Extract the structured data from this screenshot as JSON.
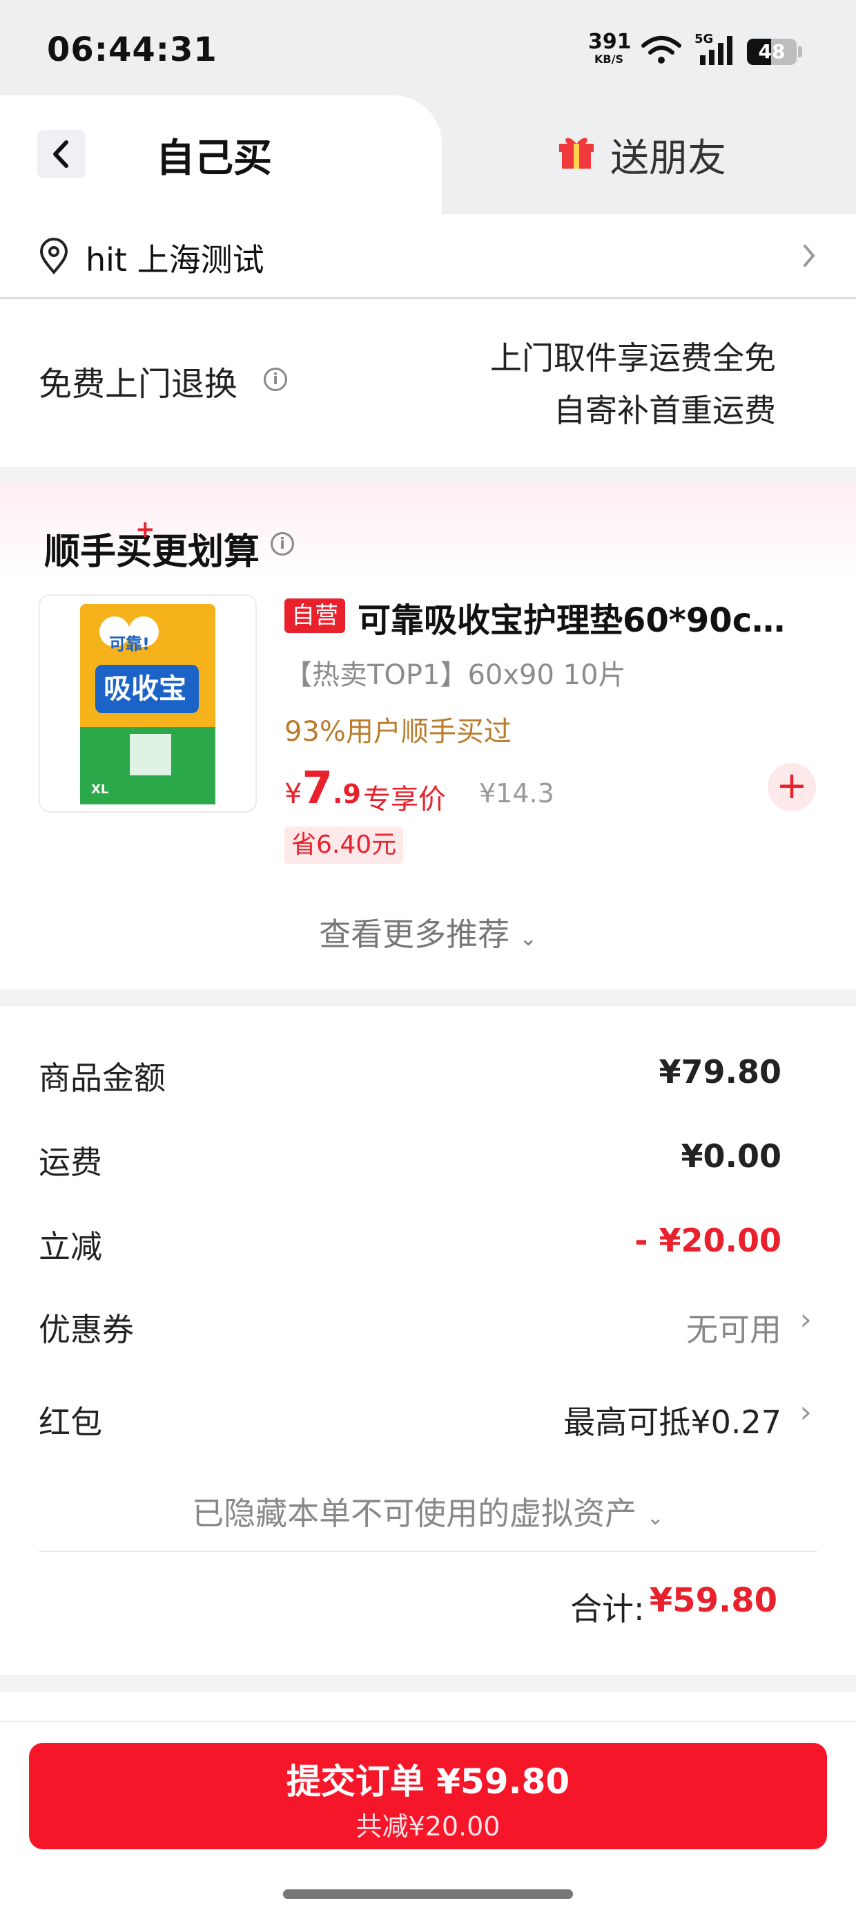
{
  "status_bar": {
    "time": "06:44:31",
    "net_speed": "391",
    "net_unit": "KB/S",
    "network": "5G",
    "battery": "48",
    "battery_level": 0.48
  },
  "tabs": {
    "self_buy": "自己买",
    "gift": "送朋友"
  },
  "address": {
    "text": "hit  上海测试"
  },
  "return_policy": {
    "label": "免费上门退换",
    "line1": "上门取件享运费全免",
    "line2": "自寄补首重运费"
  },
  "addon": {
    "title_prefix": "顺手买",
    "title_suffix": "更划算",
    "plus": "+",
    "product": {
      "badge": "自营",
      "title": "可靠吸收宝护理垫60*90cm ...",
      "spec": "【热卖TOP1】60x90 10片",
      "bought": "93%用户顺手买过",
      "price_currency": "¥",
      "price_int": "7",
      "price_dec": ".9",
      "price_tag": "专享价",
      "original_price": "¥14.3",
      "save": "省6.40元",
      "image_brand": "吸收宝",
      "image_top": "可靠!",
      "image_size": "XL"
    },
    "see_more": "查看更多推荐"
  },
  "summary": {
    "goods_label": "商品金额",
    "goods_value": "¥79.80",
    "shipping_label": "运费",
    "shipping_value": "¥0.00",
    "discount_label": "立减",
    "discount_value": "- ¥20.00",
    "coupon_label": "优惠券",
    "coupon_value": "无可用",
    "redpacket_label": "红包",
    "redpacket_value": "最高可抵¥0.27",
    "hidden_assets": "已隐藏本单不可使用的虚拟资产",
    "total_label": "合计:",
    "total_value": "¥59.80"
  },
  "submit": {
    "main": "提交订单 ¥59.80",
    "sub": "共减¥20.00"
  },
  "colors": {
    "accent_red": "#e8212c",
    "submit_red": "#f5162a",
    "gold": "#b97c2e"
  }
}
